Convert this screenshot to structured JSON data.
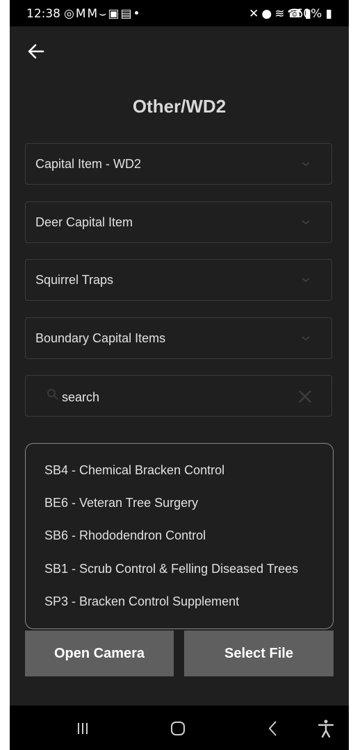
{
  "status_bar": {
    "time": "12:38",
    "left_icons": [
      "whatsapp-icon",
      "gmail-icon",
      "gmail-icon",
      "voicemail-icon",
      "gallery-icon",
      "ge-icon",
      "dot-icon"
    ],
    "right_icons": [
      "mute-icon",
      "location-icon",
      "wifi-icon",
      "wifi-calling-icon",
      "signal-icon"
    ],
    "battery": "60%"
  },
  "header": {
    "title": "Other/WD2"
  },
  "dropdowns": [
    {
      "label": "Capital Item - WD2"
    },
    {
      "label": "Deer Capital Item"
    },
    {
      "label": "Squirrel Traps"
    },
    {
      "label": "Boundary Capital Items"
    }
  ],
  "search": {
    "placeholder": "search"
  },
  "options": [
    "SB4 - Chemical Bracken Control",
    "BE6 - Veteran Tree Surgery",
    "SB6 - Rhododendron Control",
    "SB1 - Scrub Control & Felling Diseased Trees",
    "SP3 - Bracken Control Supplement"
  ],
  "buttons": {
    "open_camera": "Open Camera",
    "select_file": "Select File"
  },
  "colors": {
    "background": "#1f1f1f",
    "button": "#5f5f5f",
    "list_border": "#8a8a8a"
  }
}
